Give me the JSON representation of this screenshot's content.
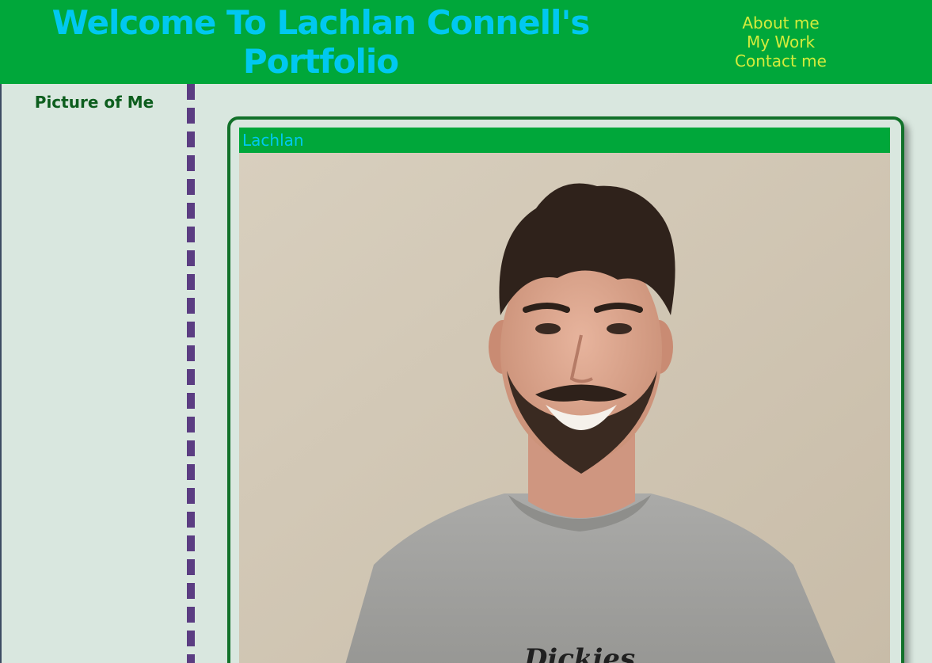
{
  "header": {
    "title": "Welcome To Lachlan Connell's Portfolio"
  },
  "nav": {
    "items": [
      "About me",
      "My Work",
      "Contact me"
    ]
  },
  "sidebar": {
    "title": "Picture of Me"
  },
  "card": {
    "title": "Lachlan",
    "photo_shirt_text": "Dickies"
  },
  "colors": {
    "header_bg": "#00a73a",
    "title_text": "#00c8f0",
    "nav_text": "#d4ec3c",
    "page_bg": "#d9e7df",
    "sidebar_title": "#0d5e1e",
    "divider": "#5b3d82",
    "card_border": "#12712a"
  }
}
